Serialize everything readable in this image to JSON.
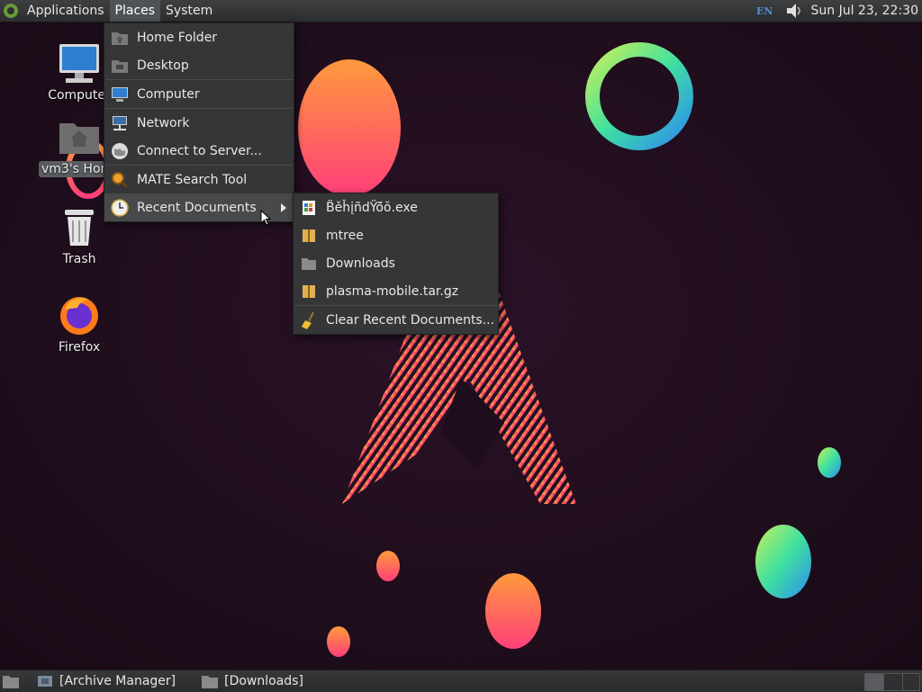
{
  "top_panel": {
    "menus": [
      "Applications",
      "Places",
      "System"
    ],
    "lang": "EN",
    "clock": "Sun Jul 23, 22:30"
  },
  "desktop": {
    "icons": [
      {
        "label": "Computer",
        "icon": "computer-icon"
      },
      {
        "label": "vm3's Home",
        "icon": "home-folder-icon"
      },
      {
        "label": "Trash",
        "icon": "trash-icon"
      },
      {
        "label": "Firefox",
        "icon": "firefox-icon"
      }
    ]
  },
  "places_menu": {
    "items": [
      {
        "label": "Home Folder",
        "icon": "home-folder-icon"
      },
      {
        "label": "Desktop",
        "icon": "desktop-folder-icon"
      },
      {
        "label": "Computer",
        "icon": "computer-icon"
      },
      {
        "label": "Network",
        "icon": "network-icon"
      },
      {
        "label": "Connect to Server...",
        "icon": "globe-icon"
      },
      {
        "label": "MATE Search Tool",
        "icon": "search-icon"
      },
      {
        "label": "Recent Documents",
        "icon": "clock-icon"
      }
    ]
  },
  "recent_menu": {
    "items": [
      {
        "label": "B̈ěȟįñdŸö̆ŏ.exe",
        "icon": "exe-file-icon"
      },
      {
        "label": "mtree",
        "icon": "archive-file-icon"
      },
      {
        "label": "Downloads",
        "icon": "folder-icon"
      },
      {
        "label": "plasma-mobile.tar.gz",
        "icon": "archive-file-icon"
      },
      {
        "label": "Clear Recent Documents...",
        "icon": "broom-icon"
      }
    ]
  },
  "taskbar": {
    "tasks": [
      {
        "label": "[Archive Manager]",
        "icon": "archive-manager-icon"
      },
      {
        "label": "[Downloads]",
        "icon": "folder-icon"
      }
    ]
  },
  "colors": {
    "accent": "#4f8fd8",
    "panel": "#2c2d2f",
    "menu_bg": "#353638"
  }
}
